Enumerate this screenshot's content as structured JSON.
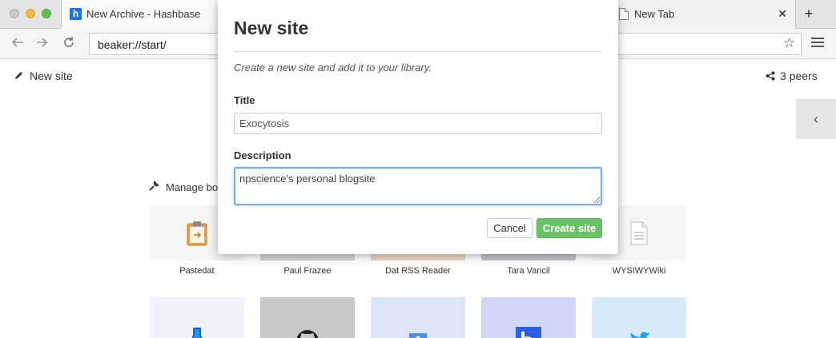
{
  "browser": {
    "tabs": [
      {
        "title": "New Archive - Hashbase",
        "favicon": "h"
      },
      {
        "title": "New Tab",
        "favicon": "document-icon"
      }
    ],
    "new_tab_label": "+",
    "close_label": "✕",
    "url": "beaker://start/"
  },
  "page": {
    "new_site_label": "New site",
    "peers_label": "3 peers",
    "manage_label": "Manage bo",
    "bookmarks": [
      {
        "label": "Pastedat",
        "icon": "clipboard-icon"
      },
      {
        "label": "Paul Frazee",
        "icon": "profile-image"
      },
      {
        "label": "Dat RSS Reader",
        "icon": "rss-reader-image"
      },
      {
        "label": "Tara Vancil",
        "icon": "profile-image"
      },
      {
        "label": "WYSIWYWiki",
        "icon": "document-icon"
      },
      {
        "label": "",
        "icon": "flask-icon"
      },
      {
        "label": "",
        "icon": "github-icon"
      },
      {
        "label": "",
        "icon": "chat-icon"
      },
      {
        "label": "",
        "icon": "hashbase-icon"
      },
      {
        "label": "",
        "icon": "twitter-icon"
      }
    ]
  },
  "modal": {
    "title": "New site",
    "description": "Create a new site and add it to your library.",
    "title_label": "Title",
    "title_value": "Exocytosis",
    "description_label": "Description",
    "description_value": "npscience's personal blogsite",
    "cancel_label": "Cancel",
    "create_label": "Create site"
  },
  "colors": {
    "create_button": "#6cc26a",
    "focus_ring": "#79aee8"
  }
}
